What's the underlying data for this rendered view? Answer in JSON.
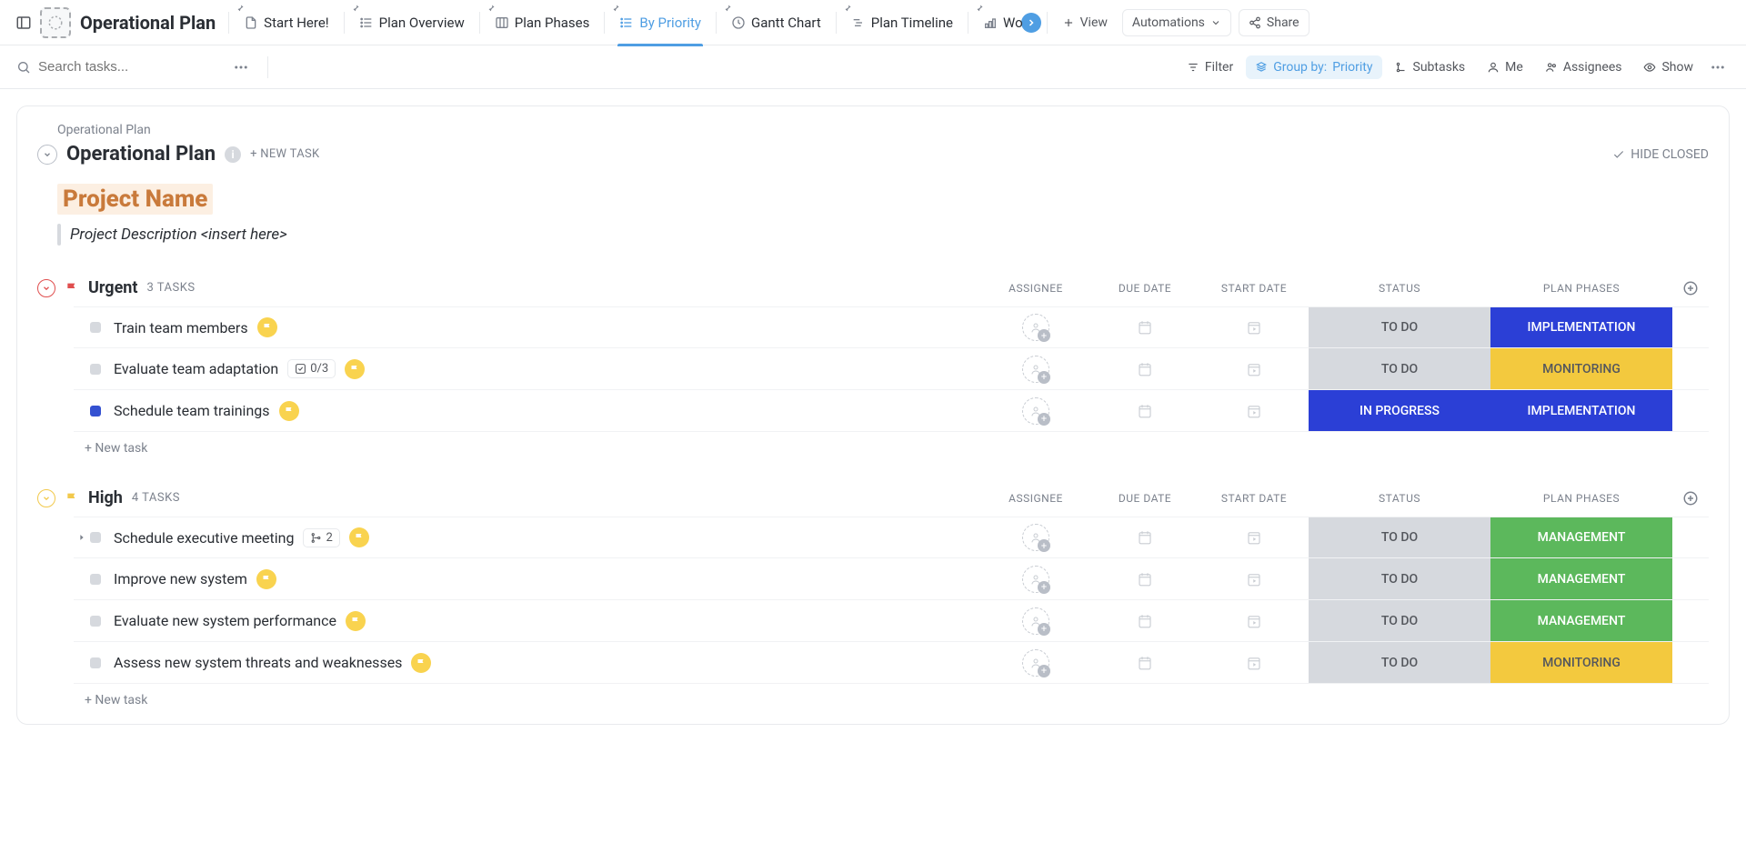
{
  "header": {
    "title": "Operational Plan",
    "tabs": [
      {
        "label": "Start Here!"
      },
      {
        "label": "Plan Overview"
      },
      {
        "label": "Plan Phases"
      },
      {
        "label": "By Priority"
      },
      {
        "label": "Gantt Chart"
      },
      {
        "label": "Plan Timeline"
      },
      {
        "label": "Wo"
      }
    ],
    "view": "View",
    "automations": "Automations",
    "share": "Share"
  },
  "toolbar": {
    "search_placeholder": "Search tasks...",
    "filter": "Filter",
    "groupby_label": "Group by:",
    "groupby_value": "Priority",
    "subtasks": "Subtasks",
    "me": "Me",
    "assignees": "Assignees",
    "show": "Show"
  },
  "card": {
    "breadcrumb": "Operational Plan",
    "title": "Operational Plan",
    "newtask": "+ NEW TASK",
    "hide_closed": "HIDE CLOSED",
    "project_name": "Project Name",
    "project_desc": "Project Description <insert here>"
  },
  "columns": {
    "assignee": "ASSIGNEE",
    "due": "DUE DATE",
    "start": "START DATE",
    "status": "STATUS",
    "phase": "PLAN PHASES"
  },
  "groups": [
    {
      "name": "Urgent",
      "color": "red",
      "count": "3 TASKS",
      "tasks": [
        {
          "name": "Train team members",
          "dot": "grey",
          "flag": true,
          "status": "TO DO",
          "status_bg": "bg-grey",
          "phase": "IMPLEMENTATION",
          "phase_bg": "bg-blue"
        },
        {
          "name": "Evaluate team adaptation",
          "dot": "grey",
          "flag": true,
          "sub": "0/3",
          "sub_type": "check",
          "status": "TO DO",
          "status_bg": "bg-grey",
          "phase": "MONITORING",
          "phase_bg": "bg-yellow"
        },
        {
          "name": "Schedule team trainings",
          "dot": "blue",
          "flag": true,
          "status": "IN PROGRESS",
          "status_bg": "bg-blue",
          "phase": "IMPLEMENTATION",
          "phase_bg": "bg-blue"
        }
      ],
      "newtask": "+ New task"
    },
    {
      "name": "High",
      "color": "yellow",
      "count": "4 TASKS",
      "tasks": [
        {
          "name": "Schedule executive meeting",
          "dot": "grey",
          "flag": true,
          "sub": "2",
          "sub_type": "branch",
          "expand": true,
          "status": "TO DO",
          "status_bg": "bg-grey",
          "phase": "MANAGEMENT",
          "phase_bg": "bg-green"
        },
        {
          "name": "Improve new system",
          "dot": "grey",
          "flag": true,
          "status": "TO DO",
          "status_bg": "bg-grey",
          "phase": "MANAGEMENT",
          "phase_bg": "bg-green"
        },
        {
          "name": "Evaluate new system performance",
          "dot": "grey",
          "flag": true,
          "status": "TO DO",
          "status_bg": "bg-grey",
          "phase": "MANAGEMENT",
          "phase_bg": "bg-green"
        },
        {
          "name": "Assess new system threats and weaknesses",
          "dot": "grey",
          "flag": true,
          "status": "TO DO",
          "status_bg": "bg-grey",
          "phase": "MONITORING",
          "phase_bg": "bg-yellow"
        }
      ],
      "newtask": "+ New task"
    }
  ]
}
